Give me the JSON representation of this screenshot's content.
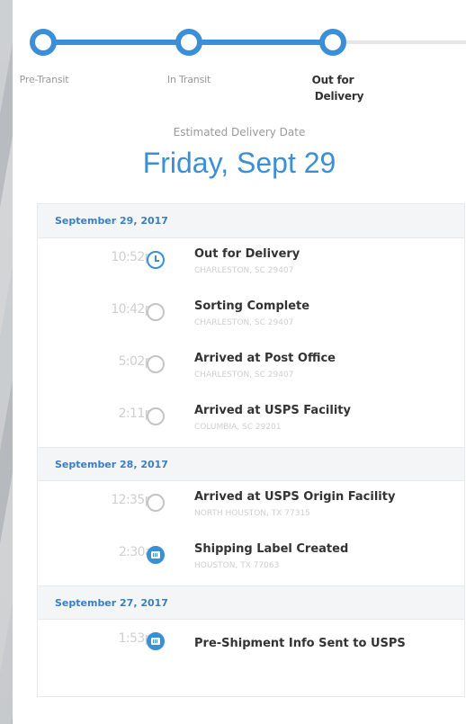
{
  "progress": {
    "steps": [
      {
        "label": "Pre-Transit"
      },
      {
        "label": "In Transit"
      },
      {
        "label": "Out for",
        "label2": "Delivery"
      }
    ]
  },
  "estimate": {
    "label": "Estimated Delivery Date",
    "date": "Friday, Sept 29"
  },
  "history": [
    {
      "date": "September 29, 2017",
      "events": [
        {
          "time": "10:52pm",
          "title": "Out for Delivery",
          "location": "CHARLESTON, SC 29407",
          "icon": "clock-icon"
        },
        {
          "time": "10:42pm",
          "title": "Sorting Complete",
          "location": "CHARLESTON, SC 29407",
          "icon": "circle-icon"
        },
        {
          "time": "5:02pm",
          "title": "Arrived at Post Office",
          "location": "CHARLESTON, SC 29407",
          "icon": "circle-icon"
        },
        {
          "time": "2:11pm",
          "title": "Arrived at USPS Facility",
          "location": "COLUMBIA, SC 29201",
          "icon": "circle-icon"
        }
      ]
    },
    {
      "date": "September 28, 2017",
      "events": [
        {
          "time": "12:35pm",
          "title": "Arrived at USPS Origin Facility",
          "location": "NORTH HOUSTON, TX 77315",
          "icon": "circle-icon"
        },
        {
          "time": "2:30am",
          "title": "Shipping Label Created",
          "location": "HOUSTON, TX 77063",
          "icon": "label-icon"
        }
      ]
    },
    {
      "date": "September 27, 2017",
      "events": [
        {
          "time": "1:53pm",
          "title": "Pre-Shipment Info Sent to USPS",
          "location": "",
          "icon": "label-icon"
        }
      ]
    }
  ]
}
